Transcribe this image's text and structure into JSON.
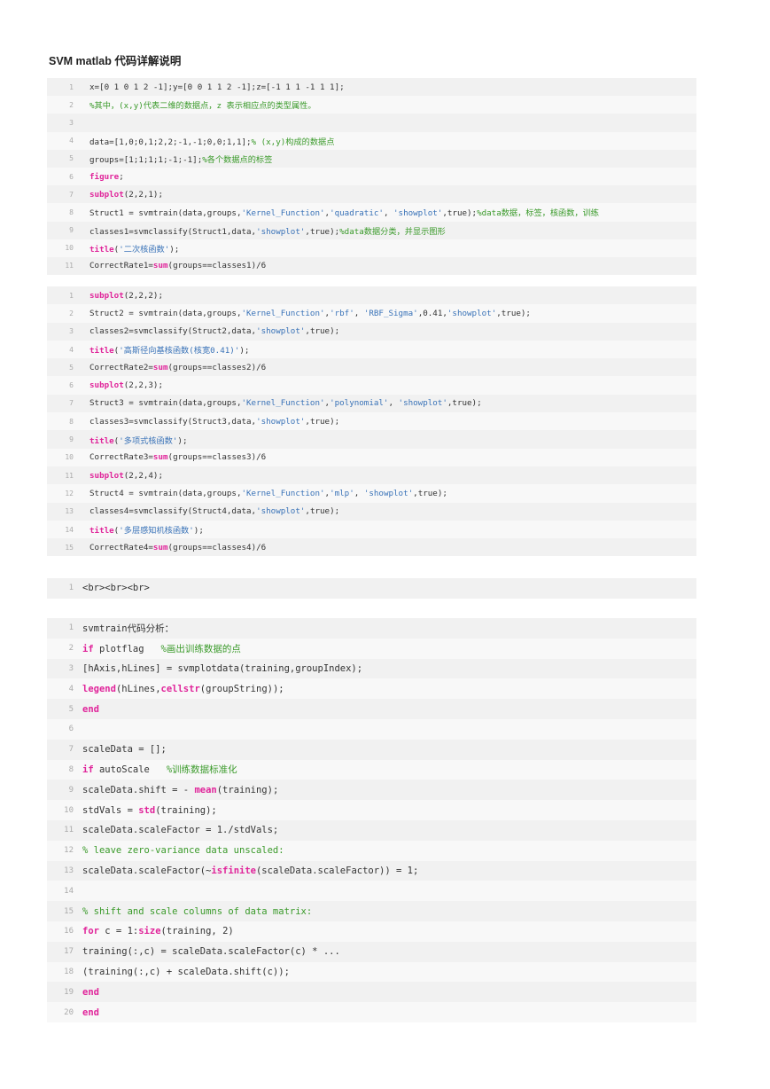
{
  "title": "SVM matlab 代码详解说明",
  "block1": {
    "lines": [
      {
        "n": "1",
        "segs": [
          [
            "x=[0 1 0 1 2 -1];y=[0 0 1 1 2 -1];z=[-1 1 1 -1 1 1];",
            ""
          ]
        ]
      },
      {
        "n": "2",
        "segs": [
          [
            "%其中，(x,y)代表二维的数据点，z 表示相应点的类型属性。",
            "c"
          ]
        ]
      },
      {
        "n": "3",
        "segs": []
      },
      {
        "n": "4",
        "segs": [
          [
            "data=[1,0;0,1;2,2;-1,-1;0,0;1,1];",
            ""
          ],
          [
            "% (x,y)构成的数据点",
            "c"
          ]
        ]
      },
      {
        "n": "5",
        "segs": [
          [
            "groups=[1;1;1;1;-1;-1];",
            ""
          ],
          [
            "%各个数据点的标签",
            "c"
          ]
        ]
      },
      {
        "n": "6",
        "segs": [
          [
            "figure",
            "k"
          ],
          [
            ";",
            ""
          ]
        ]
      },
      {
        "n": "7",
        "segs": [
          [
            "subplot",
            "k"
          ],
          [
            "(2,2,1);",
            ""
          ]
        ]
      },
      {
        "n": "8",
        "segs": [
          [
            "Struct1 = svmtrain(data,groups,",
            ""
          ],
          [
            "'Kernel_Function'",
            "s"
          ],
          [
            ",",
            ""
          ],
          [
            "'quadratic'",
            "s"
          ],
          [
            ", ",
            ""
          ],
          [
            "'showplot'",
            "s"
          ],
          [
            ",true);",
            ""
          ],
          [
            "%data数据，标签，核函数，训练",
            "c"
          ]
        ]
      },
      {
        "n": "9",
        "segs": [
          [
            "classes1=svmclassify(Struct1,data,",
            ""
          ],
          [
            "'showplot'",
            "s"
          ],
          [
            ",true);",
            ""
          ],
          [
            "%data数据分类，并显示图形",
            "c"
          ]
        ]
      },
      {
        "n": "10",
        "segs": [
          [
            "title",
            "k"
          ],
          [
            "(",
            ""
          ],
          [
            "'二次核函数'",
            "s"
          ],
          [
            ");",
            ""
          ]
        ]
      },
      {
        "n": "11",
        "segs": [
          [
            "CorrectRate1=",
            ""
          ],
          [
            "sum",
            "k"
          ],
          [
            "(groups==classes1)/6",
            ""
          ]
        ]
      }
    ]
  },
  "block2": {
    "lines": [
      {
        "n": "1",
        "segs": [
          [
            "subplot",
            "k"
          ],
          [
            "(2,2,2);",
            ""
          ]
        ]
      },
      {
        "n": "2",
        "segs": [
          [
            "Struct2 = svmtrain(data,groups,",
            ""
          ],
          [
            "'Kernel_Function'",
            "s"
          ],
          [
            ",",
            ""
          ],
          [
            "'rbf'",
            "s"
          ],
          [
            ", ",
            ""
          ],
          [
            "'RBF_Sigma'",
            "s"
          ],
          [
            ",0.41,",
            ""
          ],
          [
            "'showplot'",
            "s"
          ],
          [
            ",true);",
            ""
          ]
        ]
      },
      {
        "n": "3",
        "segs": [
          [
            "classes2=svmclassify(Struct2,data,",
            ""
          ],
          [
            "'showplot'",
            "s"
          ],
          [
            ",true);",
            ""
          ]
        ]
      },
      {
        "n": "4",
        "segs": [
          [
            "title",
            "k"
          ],
          [
            "(",
            ""
          ],
          [
            "'高斯径向基核函数(核宽0.41)'",
            "s"
          ],
          [
            ");",
            ""
          ]
        ]
      },
      {
        "n": "5",
        "segs": [
          [
            "CorrectRate2=",
            ""
          ],
          [
            "sum",
            "k"
          ],
          [
            "(groups==classes2)/6",
            ""
          ]
        ]
      },
      {
        "n": "6",
        "segs": [
          [
            "subplot",
            "k"
          ],
          [
            "(2,2,3);",
            ""
          ]
        ]
      },
      {
        "n": "7",
        "segs": [
          [
            "Struct3 = svmtrain(data,groups,",
            ""
          ],
          [
            "'Kernel_Function'",
            "s"
          ],
          [
            ",",
            ""
          ],
          [
            "'polynomial'",
            "s"
          ],
          [
            ", ",
            ""
          ],
          [
            "'showplot'",
            "s"
          ],
          [
            ",true);",
            ""
          ]
        ]
      },
      {
        "n": "8",
        "segs": [
          [
            "classes3=svmclassify(Struct3,data,",
            ""
          ],
          [
            "'showplot'",
            "s"
          ],
          [
            ",true);",
            ""
          ]
        ]
      },
      {
        "n": "9",
        "segs": [
          [
            "title",
            "k"
          ],
          [
            "(",
            ""
          ],
          [
            "'多项式核函数'",
            "s"
          ],
          [
            ");",
            ""
          ]
        ]
      },
      {
        "n": "10",
        "segs": [
          [
            "CorrectRate3=",
            ""
          ],
          [
            "sum",
            "k"
          ],
          [
            "(groups==classes3)/6",
            ""
          ]
        ]
      },
      {
        "n": "11",
        "segs": [
          [
            "subplot",
            "k"
          ],
          [
            "(2,2,4);",
            ""
          ]
        ]
      },
      {
        "n": "12",
        "segs": [
          [
            "Struct4 = svmtrain(data,groups,",
            ""
          ],
          [
            "'Kernel_Function'",
            "s"
          ],
          [
            ",",
            ""
          ],
          [
            "'mlp'",
            "s"
          ],
          [
            ", ",
            ""
          ],
          [
            "'showplot'",
            "s"
          ],
          [
            ",true);",
            ""
          ]
        ]
      },
      {
        "n": "13",
        "segs": [
          [
            "classes4=svmclassify(Struct4,data,",
            ""
          ],
          [
            "'showplot'",
            "s"
          ],
          [
            ",true);",
            ""
          ]
        ]
      },
      {
        "n": "14",
        "segs": [
          [
            "title",
            "k"
          ],
          [
            "(",
            ""
          ],
          [
            "'多层感知机核函数'",
            "s"
          ],
          [
            ");",
            ""
          ]
        ]
      },
      {
        "n": "15",
        "segs": [
          [
            "CorrectRate4=",
            ""
          ],
          [
            "sum",
            "k"
          ],
          [
            "(groups==classes4)/6",
            ""
          ]
        ]
      }
    ]
  },
  "block3": {
    "lines": [
      {
        "n": "1",
        "segs": [
          [
            "<br><br><br>",
            ""
          ]
        ]
      }
    ]
  },
  "block4": {
    "lines": [
      {
        "n": "1",
        "segs": [
          [
            "svmtrain代码分析：",
            ""
          ]
        ]
      },
      {
        "n": "2",
        "segs": [
          [
            "if",
            "k"
          ],
          [
            " plotflag   ",
            ""
          ],
          [
            "%画出训练数据的点",
            "c"
          ]
        ]
      },
      {
        "n": "3",
        "segs": [
          [
            "[hAxis,hLines] = svmplotdata(training,groupIndex);",
            ""
          ]
        ]
      },
      {
        "n": "4",
        "segs": [
          [
            "legend",
            "k"
          ],
          [
            "(hLines,",
            ""
          ],
          [
            "cellstr",
            "k"
          ],
          [
            "(groupString));",
            ""
          ]
        ]
      },
      {
        "n": "5",
        "segs": [
          [
            "end",
            "k"
          ]
        ]
      },
      {
        "n": "6",
        "segs": []
      },
      {
        "n": "7",
        "segs": [
          [
            "scaleData = [];",
            ""
          ]
        ]
      },
      {
        "n": "8",
        "segs": [
          [
            "if",
            "k"
          ],
          [
            " autoScale   ",
            ""
          ],
          [
            "%训练数据标准化",
            "c"
          ]
        ]
      },
      {
        "n": "9",
        "segs": [
          [
            "scaleData.shift = - ",
            ""
          ],
          [
            "mean",
            "k"
          ],
          [
            "(training);",
            ""
          ]
        ]
      },
      {
        "n": "10",
        "segs": [
          [
            "stdVals = ",
            ""
          ],
          [
            "std",
            "k"
          ],
          [
            "(training);",
            ""
          ]
        ]
      },
      {
        "n": "11",
        "segs": [
          [
            "scaleData.scaleFactor = 1./stdVals;",
            ""
          ]
        ]
      },
      {
        "n": "12",
        "segs": [
          [
            "% leave zero-variance data unscaled:",
            "c"
          ]
        ]
      },
      {
        "n": "13",
        "segs": [
          [
            "scaleData.scaleFactor(~",
            ""
          ],
          [
            "isfinite",
            "k"
          ],
          [
            "(scaleData.scaleFactor)) = 1;",
            ""
          ]
        ]
      },
      {
        "n": "14",
        "segs": []
      },
      {
        "n": "15",
        "segs": [
          [
            "% shift and scale columns of data matrix:",
            "c"
          ]
        ]
      },
      {
        "n": "16",
        "segs": [
          [
            "for",
            "k"
          ],
          [
            " c = 1:",
            ""
          ],
          [
            "size",
            "k"
          ],
          [
            "(training, 2)",
            ""
          ]
        ]
      },
      {
        "n": "17",
        "segs": [
          [
            "training(:,c) = scaleData.scaleFactor(c) * ...",
            ""
          ]
        ]
      },
      {
        "n": "18",
        "segs": [
          [
            "(training(:,c) + scaleData.shift(c));",
            ""
          ]
        ]
      },
      {
        "n": "19",
        "segs": [
          [
            "end",
            "k"
          ]
        ]
      },
      {
        "n": "20",
        "segs": [
          [
            "end",
            "k"
          ]
        ]
      }
    ]
  }
}
